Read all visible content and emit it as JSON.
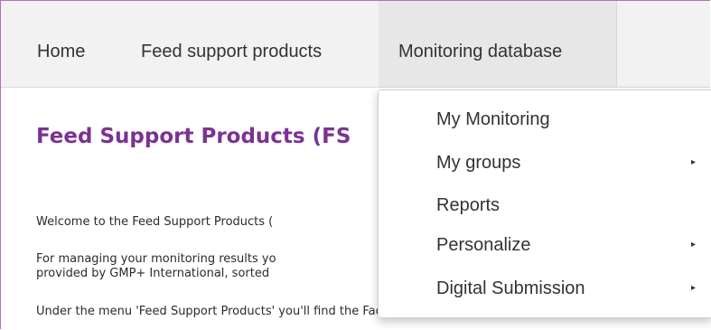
{
  "nav": {
    "home": "Home",
    "feed_support_products": "Feed support products",
    "monitoring_database": "Monitoring database"
  },
  "page": {
    "title": "Feed Support Products (FS",
    "paragraphs": [
      "Welcome to the Feed Support Products (",
      "For managing your monitoring results yo",
      "provided by GMP+ International, sorted",
      "Under the menu 'Feed Support Products' you'll find the Fact Sheets, the product"
    ]
  },
  "dropdown": {
    "items": [
      {
        "label": "My Monitoring",
        "submenu": false
      },
      {
        "label": "My groups",
        "submenu": true,
        "arrow": "▸"
      },
      {
        "label": "Reports",
        "submenu": false
      },
      {
        "label": "Personalize",
        "submenu": true,
        "arrow": "▸"
      },
      {
        "label": "Digital Submission",
        "submenu": true,
        "arrow": "▸"
      }
    ]
  },
  "colors": {
    "accent": "#7b3294",
    "frame_border": "#b46fb6",
    "navbar_bg": "#f2f2f2"
  }
}
